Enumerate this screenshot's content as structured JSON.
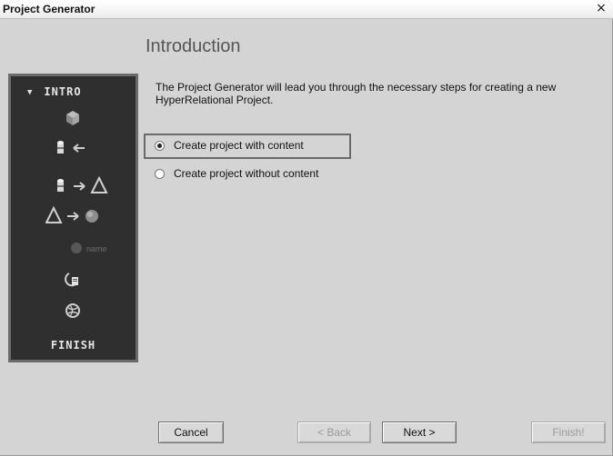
{
  "window": {
    "title": "Project Generator",
    "close_label": "×"
  },
  "page": {
    "heading": "Introduction",
    "description": "The Project Generator will lead you through the necessary steps for creating a new HyperRelational Project."
  },
  "options": [
    {
      "label": "Create project with content",
      "selected": true
    },
    {
      "label": "Create project without content",
      "selected": false
    }
  ],
  "sidebar": {
    "header": "INTRO",
    "steps": [
      "cube-icon",
      "cylinder-arrow-left-icon",
      "cylinder-arrow-triangle-icon",
      "triangle-arrow-circle-icon",
      "circle-name-icon",
      "document-icon",
      "globe-icon"
    ],
    "name_label": "name",
    "footer": "FINISH"
  },
  "buttons": {
    "cancel": "Cancel",
    "back": "< Back",
    "next": "Next >",
    "finish": "Finish!"
  },
  "colors": {
    "window_bg": "#d4d4d4",
    "sidebar_bg": "#2f2f2f",
    "sidebar_border": "#6b6b6b",
    "heading": "#555555"
  }
}
